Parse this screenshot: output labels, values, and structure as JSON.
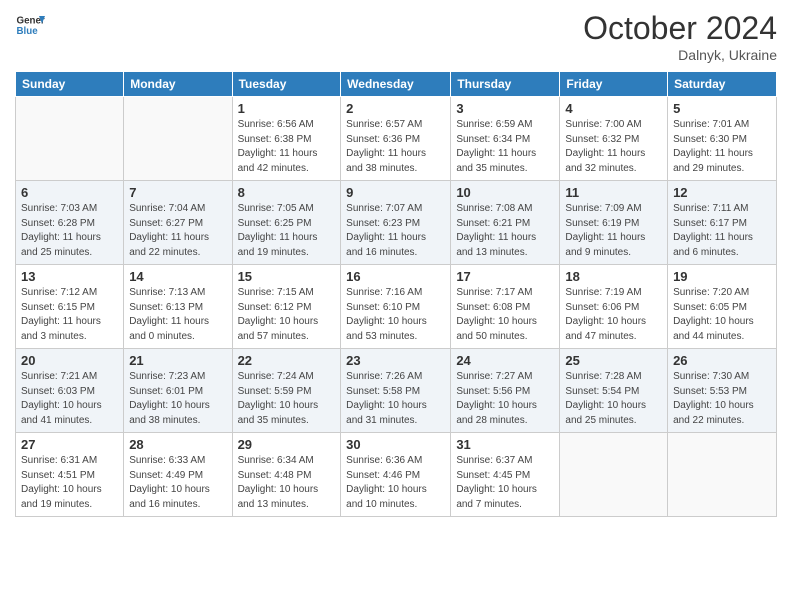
{
  "header": {
    "logo_line1": "General",
    "logo_line2": "Blue",
    "month": "October 2024",
    "location": "Dalnyk, Ukraine"
  },
  "days_of_week": [
    "Sunday",
    "Monday",
    "Tuesday",
    "Wednesday",
    "Thursday",
    "Friday",
    "Saturday"
  ],
  "weeks": [
    [
      {
        "num": "",
        "sunrise": "",
        "sunset": "",
        "daylight": ""
      },
      {
        "num": "",
        "sunrise": "",
        "sunset": "",
        "daylight": ""
      },
      {
        "num": "1",
        "sunrise": "Sunrise: 6:56 AM",
        "sunset": "Sunset: 6:38 PM",
        "daylight": "Daylight: 11 hours and 42 minutes."
      },
      {
        "num": "2",
        "sunrise": "Sunrise: 6:57 AM",
        "sunset": "Sunset: 6:36 PM",
        "daylight": "Daylight: 11 hours and 38 minutes."
      },
      {
        "num": "3",
        "sunrise": "Sunrise: 6:59 AM",
        "sunset": "Sunset: 6:34 PM",
        "daylight": "Daylight: 11 hours and 35 minutes."
      },
      {
        "num": "4",
        "sunrise": "Sunrise: 7:00 AM",
        "sunset": "Sunset: 6:32 PM",
        "daylight": "Daylight: 11 hours and 32 minutes."
      },
      {
        "num": "5",
        "sunrise": "Sunrise: 7:01 AM",
        "sunset": "Sunset: 6:30 PM",
        "daylight": "Daylight: 11 hours and 29 minutes."
      }
    ],
    [
      {
        "num": "6",
        "sunrise": "Sunrise: 7:03 AM",
        "sunset": "Sunset: 6:28 PM",
        "daylight": "Daylight: 11 hours and 25 minutes."
      },
      {
        "num": "7",
        "sunrise": "Sunrise: 7:04 AM",
        "sunset": "Sunset: 6:27 PM",
        "daylight": "Daylight: 11 hours and 22 minutes."
      },
      {
        "num": "8",
        "sunrise": "Sunrise: 7:05 AM",
        "sunset": "Sunset: 6:25 PM",
        "daylight": "Daylight: 11 hours and 19 minutes."
      },
      {
        "num": "9",
        "sunrise": "Sunrise: 7:07 AM",
        "sunset": "Sunset: 6:23 PM",
        "daylight": "Daylight: 11 hours and 16 minutes."
      },
      {
        "num": "10",
        "sunrise": "Sunrise: 7:08 AM",
        "sunset": "Sunset: 6:21 PM",
        "daylight": "Daylight: 11 hours and 13 minutes."
      },
      {
        "num": "11",
        "sunrise": "Sunrise: 7:09 AM",
        "sunset": "Sunset: 6:19 PM",
        "daylight": "Daylight: 11 hours and 9 minutes."
      },
      {
        "num": "12",
        "sunrise": "Sunrise: 7:11 AM",
        "sunset": "Sunset: 6:17 PM",
        "daylight": "Daylight: 11 hours and 6 minutes."
      }
    ],
    [
      {
        "num": "13",
        "sunrise": "Sunrise: 7:12 AM",
        "sunset": "Sunset: 6:15 PM",
        "daylight": "Daylight: 11 hours and 3 minutes."
      },
      {
        "num": "14",
        "sunrise": "Sunrise: 7:13 AM",
        "sunset": "Sunset: 6:13 PM",
        "daylight": "Daylight: 11 hours and 0 minutes."
      },
      {
        "num": "15",
        "sunrise": "Sunrise: 7:15 AM",
        "sunset": "Sunset: 6:12 PM",
        "daylight": "Daylight: 10 hours and 57 minutes."
      },
      {
        "num": "16",
        "sunrise": "Sunrise: 7:16 AM",
        "sunset": "Sunset: 6:10 PM",
        "daylight": "Daylight: 10 hours and 53 minutes."
      },
      {
        "num": "17",
        "sunrise": "Sunrise: 7:17 AM",
        "sunset": "Sunset: 6:08 PM",
        "daylight": "Daylight: 10 hours and 50 minutes."
      },
      {
        "num": "18",
        "sunrise": "Sunrise: 7:19 AM",
        "sunset": "Sunset: 6:06 PM",
        "daylight": "Daylight: 10 hours and 47 minutes."
      },
      {
        "num": "19",
        "sunrise": "Sunrise: 7:20 AM",
        "sunset": "Sunset: 6:05 PM",
        "daylight": "Daylight: 10 hours and 44 minutes."
      }
    ],
    [
      {
        "num": "20",
        "sunrise": "Sunrise: 7:21 AM",
        "sunset": "Sunset: 6:03 PM",
        "daylight": "Daylight: 10 hours and 41 minutes."
      },
      {
        "num": "21",
        "sunrise": "Sunrise: 7:23 AM",
        "sunset": "Sunset: 6:01 PM",
        "daylight": "Daylight: 10 hours and 38 minutes."
      },
      {
        "num": "22",
        "sunrise": "Sunrise: 7:24 AM",
        "sunset": "Sunset: 5:59 PM",
        "daylight": "Daylight: 10 hours and 35 minutes."
      },
      {
        "num": "23",
        "sunrise": "Sunrise: 7:26 AM",
        "sunset": "Sunset: 5:58 PM",
        "daylight": "Daylight: 10 hours and 31 minutes."
      },
      {
        "num": "24",
        "sunrise": "Sunrise: 7:27 AM",
        "sunset": "Sunset: 5:56 PM",
        "daylight": "Daylight: 10 hours and 28 minutes."
      },
      {
        "num": "25",
        "sunrise": "Sunrise: 7:28 AM",
        "sunset": "Sunset: 5:54 PM",
        "daylight": "Daylight: 10 hours and 25 minutes."
      },
      {
        "num": "26",
        "sunrise": "Sunrise: 7:30 AM",
        "sunset": "Sunset: 5:53 PM",
        "daylight": "Daylight: 10 hours and 22 minutes."
      }
    ],
    [
      {
        "num": "27",
        "sunrise": "Sunrise: 6:31 AM",
        "sunset": "Sunset: 4:51 PM",
        "daylight": "Daylight: 10 hours and 19 minutes."
      },
      {
        "num": "28",
        "sunrise": "Sunrise: 6:33 AM",
        "sunset": "Sunset: 4:49 PM",
        "daylight": "Daylight: 10 hours and 16 minutes."
      },
      {
        "num": "29",
        "sunrise": "Sunrise: 6:34 AM",
        "sunset": "Sunset: 4:48 PM",
        "daylight": "Daylight: 10 hours and 13 minutes."
      },
      {
        "num": "30",
        "sunrise": "Sunrise: 6:36 AM",
        "sunset": "Sunset: 4:46 PM",
        "daylight": "Daylight: 10 hours and 10 minutes."
      },
      {
        "num": "31",
        "sunrise": "Sunrise: 6:37 AM",
        "sunset": "Sunset: 4:45 PM",
        "daylight": "Daylight: 10 hours and 7 minutes."
      },
      {
        "num": "",
        "sunrise": "",
        "sunset": "",
        "daylight": ""
      },
      {
        "num": "",
        "sunrise": "",
        "sunset": "",
        "daylight": ""
      }
    ]
  ]
}
